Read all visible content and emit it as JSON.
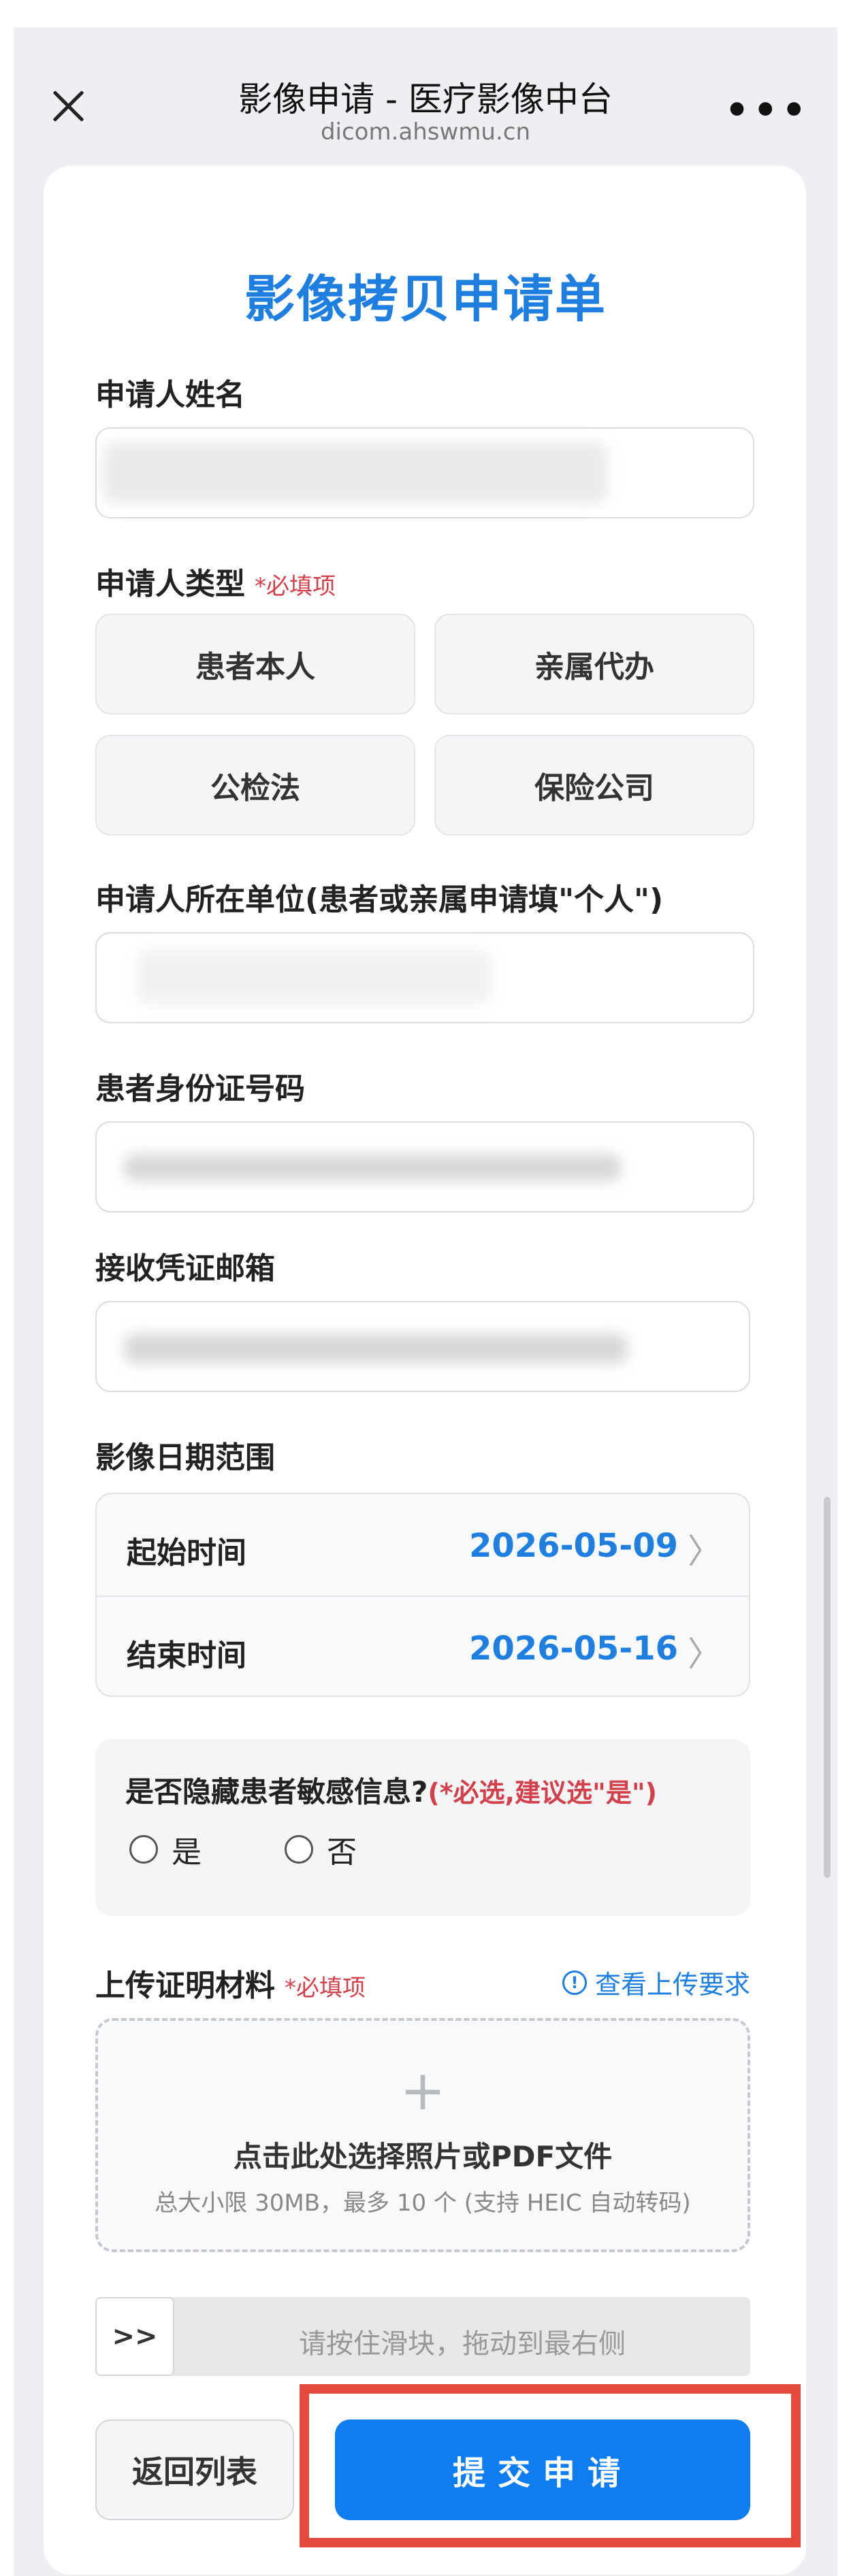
{
  "nav": {
    "title": "影像申请 - 医疗影像中台",
    "url": "dicom.ahswmu.cn",
    "more": "•••",
    "close_icon": "close-icon"
  },
  "form": {
    "title": "影像拷贝申请单",
    "applicant_name_label": "申请人姓名",
    "applicant_type_label": "申请人类型",
    "required_mark": "*必填项",
    "applicant_types": [
      "患者本人",
      "亲属代办",
      "公检法",
      "保险公司"
    ],
    "unit_label": "申请人所在单位(患者或亲属申请填\"个人\")",
    "id_label": "患者身份证号码",
    "email_label": "接收凭证邮箱",
    "date_range_label": "影像日期范围",
    "start_label": "起始时间",
    "start_value": "2026-05-09",
    "end_label": "结束时间",
    "end_value": "2026-05-16",
    "chevron": "〉",
    "sensitive_q": "是否隐藏患者敏感信息?",
    "sensitive_hint": "(*必选,建议选\"是\")",
    "yes": "是",
    "no": "否",
    "upload_label": "上传证明材料",
    "view_requirements": "查看上传要求",
    "upload_plus": "+",
    "upload_main": "点击此处选择照片或PDF文件",
    "upload_sub": "总大小限 30MB，最多 10 个 (支持 HEIC 自动转码)",
    "slider_handle": ">>",
    "slider_hint": "请按住滑块，拖动到最右侧",
    "back_button": "返回列表",
    "submit_button": "提交申请"
  },
  "colors": {
    "accent": "#1f7fe0",
    "primary_button": "#0f7df2",
    "required_red": "#d4404a",
    "highlight_red": "#e5483c"
  }
}
